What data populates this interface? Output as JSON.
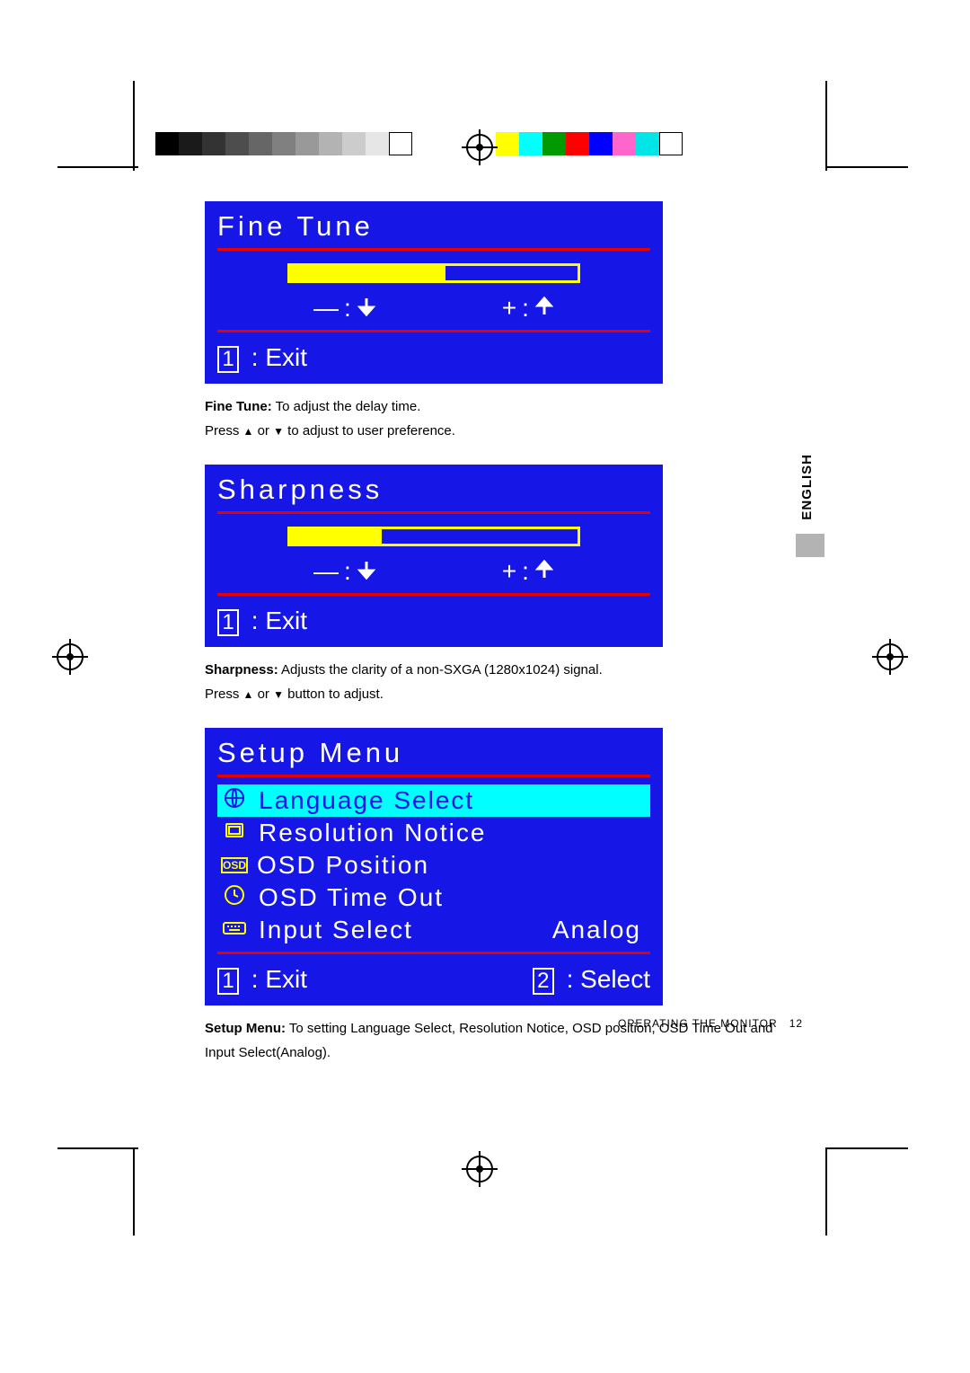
{
  "gray_swatches": [
    "#000000",
    "#1a1a1a",
    "#333333",
    "#4d4d4d",
    "#666666",
    "#808080",
    "#999999",
    "#b3b3b3",
    "#cccccc",
    "#e6e6e6",
    "#ffffff"
  ],
  "color_swatches": [
    "#ffff00",
    "#00ffff",
    "#009900",
    "#ff0000",
    "#0000ff",
    "#ff66cc",
    "#00e6e6",
    "#ffffff"
  ],
  "fine_tune": {
    "title": "Fine Tune",
    "slider_percent": 54,
    "exit_label": ": Exit",
    "exit_key": "1"
  },
  "fine_tune_caption": {
    "bold": "Fine Tune:",
    "rest": " To adjust the delay time.",
    "instr_prefix": "Press ",
    "instr_mid": " or ",
    "instr_suffix": " to adjust to user preference."
  },
  "sharpness": {
    "title": "Sharpness",
    "slider_percent": 32,
    "exit_label": ": Exit",
    "exit_key": "1"
  },
  "sharpness_caption": {
    "bold": "Sharpness:",
    "rest": " Adjusts the clarity of a non-SXGA (1280x1024) signal.",
    "instr_prefix": "Press ",
    "instr_mid": " or ",
    "instr_suffix": " button to adjust."
  },
  "setup_menu": {
    "title": "Setup Menu",
    "items": [
      {
        "icon": "globe",
        "label": "Language Select",
        "value": "",
        "selected": true
      },
      {
        "icon": "screen",
        "label": "Resolution Notice",
        "value": "",
        "selected": false
      },
      {
        "icon": "osd",
        "label": "OSD Position",
        "value": "",
        "selected": false
      },
      {
        "icon": "clock",
        "label": "OSD Time Out",
        "value": "",
        "selected": false
      },
      {
        "icon": "keyboard",
        "label": "Input Select",
        "value": "Analog",
        "selected": false
      }
    ],
    "exit_label": ": Exit",
    "exit_key": "1",
    "select_label": ": Select",
    "select_key": "2"
  },
  "setup_caption": {
    "bold": "Setup Menu:",
    "rest": " To setting Language Select, Resolution Notice, OSD position, OSD Time Out and Input Select(Analog)."
  },
  "side_tab": "ENGLISH",
  "footer": {
    "section": "OPERATING THE MONITOR",
    "page": "12"
  },
  "glyphs": {
    "minus": "—",
    "colon": ":",
    "plus": "+",
    "down": "↓",
    "up": "↑"
  }
}
